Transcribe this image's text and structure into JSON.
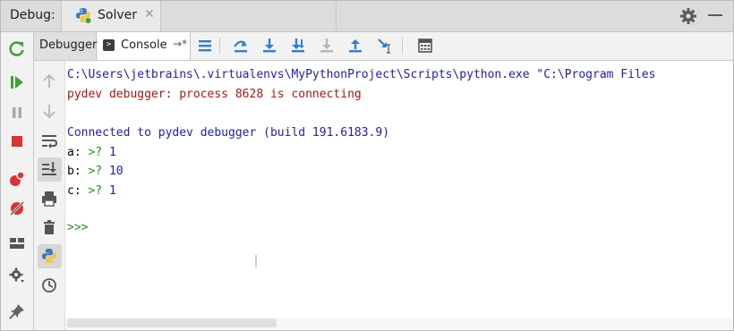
{
  "titlebar": {
    "debug_label": "Debug:",
    "run_tab": "Solver",
    "close_glyph": "✕"
  },
  "tabs": {
    "debugger": "Debugger",
    "console": "Console",
    "console_pin": "→*"
  },
  "console": {
    "lines": {
      "cmd": "C:\\Users\\jetbrains\\.virtualenvs\\MyPythonProject\\Scripts\\python.exe \"C:\\Program Files",
      "connecting": "pydev debugger: process 8628 is connecting",
      "connected": "Connected to pydev debugger (build 191.6183.9)"
    },
    "vars": [
      {
        "name": "a:",
        "arrow": ">?",
        "value": "1"
      },
      {
        "name": "b:",
        "arrow": ">?",
        "value": "10"
      },
      {
        "name": "c:",
        "arrow": ">?",
        "value": "1"
      }
    ],
    "prompt": ">>>"
  },
  "colors": {
    "accent_blue": "#2f7fd1",
    "run_green": "#3ea335",
    "stop_red": "#d93333",
    "console_blue": "#1e1ea8",
    "error_red": "#a61717",
    "prompt_green": "#2a8a1f"
  },
  "icons": {
    "titlebar": [
      "python-icon",
      "gear-icon",
      "minimize-icon"
    ],
    "left_strip": [
      "rerun-icon",
      "resume-icon",
      "pause-icon",
      "stop-icon",
      "view-breakpoints-icon",
      "mute-breakpoints-icon",
      "layout-icon",
      "settings-icon",
      "pin-icon"
    ],
    "toolbar": [
      "show-execution-point-icon",
      "step-over-icon",
      "step-into-icon",
      "step-into-my-code-icon",
      "force-step-into-icon",
      "step-out-icon",
      "run-to-cursor-icon",
      "evaluate-expression-icon"
    ],
    "console_strip": [
      "up-arrow-icon",
      "down-arrow-icon",
      "soft-wrap-icon",
      "scroll-to-end-icon",
      "print-icon",
      "trash-icon",
      "python-console-icon",
      "history-icon"
    ]
  }
}
